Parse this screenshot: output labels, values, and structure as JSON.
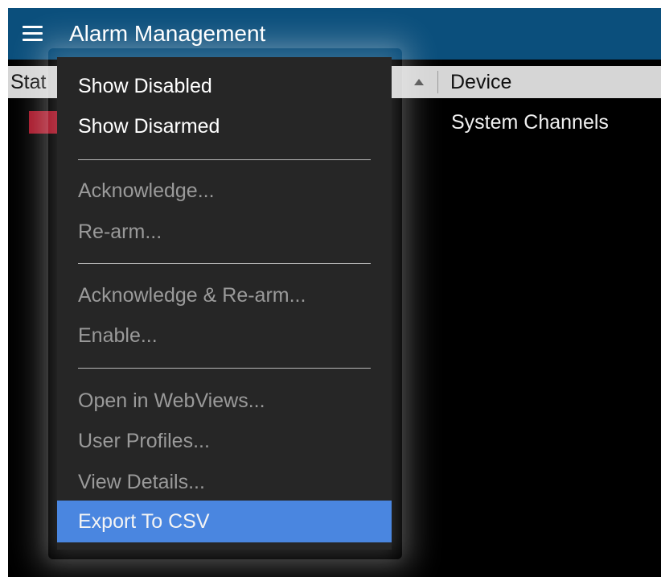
{
  "titlebar": {
    "menu_icon": "hamburger-menu-icon",
    "title": "Alarm Management",
    "color": "#0b4f7c"
  },
  "table": {
    "columns": {
      "status": "Stat",
      "device": "Device"
    },
    "sort_icon": "sort-ascending-icon",
    "rows": [
      {
        "status_color": "#a61427",
        "device": "System Channels"
      }
    ]
  },
  "context_menu": {
    "items": [
      {
        "label": "Show Disabled",
        "enabled": true
      },
      {
        "label": "Show Disarmed",
        "enabled": true
      },
      {
        "label": "Acknowledge...",
        "enabled": false
      },
      {
        "label": "Re-arm...",
        "enabled": false
      },
      {
        "label": "Acknowledge & Re-arm...",
        "enabled": false
      },
      {
        "label": "Enable...",
        "enabled": false
      },
      {
        "label": "Open in WebViews...",
        "enabled": false
      },
      {
        "label": "User Profiles...",
        "enabled": false
      },
      {
        "label": "View Details...",
        "enabled": false
      },
      {
        "label": "Export To CSV",
        "enabled": true,
        "highlighted": true
      }
    ],
    "highlight_color": "#4a86e0",
    "background": "#262626"
  }
}
